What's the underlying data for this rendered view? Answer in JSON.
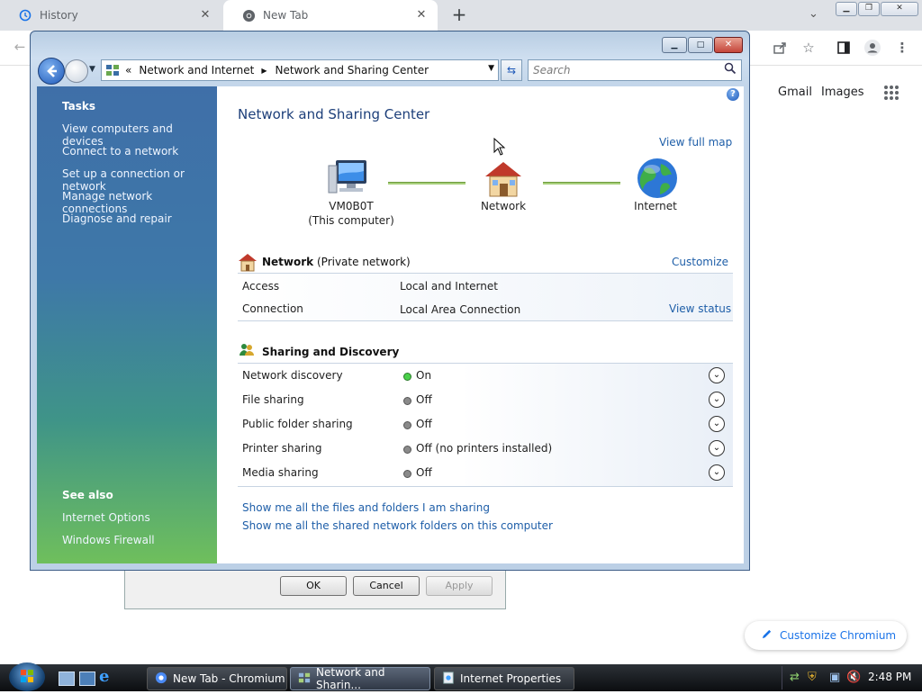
{
  "browser": {
    "tabs": [
      {
        "label": "History",
        "icon": "history-icon"
      },
      {
        "label": "New Tab",
        "icon": "chromium-icon"
      }
    ],
    "new_tab_symbol": "+",
    "ntp_links": [
      "Gmail",
      "Images"
    ],
    "customize_label": "Customize Chromium"
  },
  "props_dialog": {
    "ok": "OK",
    "cancel": "Cancel",
    "apply": "Apply"
  },
  "window": {
    "address": {
      "chevrons": "«",
      "crumb1": "Network and Internet",
      "crumb2": "Network and Sharing Center"
    },
    "search_placeholder": "Search",
    "sidebar": {
      "tasks_heading": "Tasks",
      "tasks": [
        "View computers and devices",
        "Connect to a network",
        "Set up a connection or network",
        "Manage network connections",
        "Diagnose and repair"
      ],
      "see_also_heading": "See also",
      "see_also": [
        "Internet Options",
        "Windows Firewall"
      ]
    },
    "title": "Network and Sharing Center",
    "view_full_map": "View full map",
    "map": {
      "computer_name": "VM0B0T",
      "computer_sub": "(This computer)",
      "network": "Network",
      "internet": "Internet"
    },
    "network_section": {
      "name": "Network",
      "type": "(Private network)",
      "customize": "Customize",
      "access_label": "Access",
      "access_value": "Local and Internet",
      "connection_label": "Connection",
      "connection_value": "Local Area Connection",
      "view_status": "View status"
    },
    "sharing": {
      "heading": "Sharing and Discovery",
      "rows": [
        {
          "label": "Network discovery",
          "value": "On"
        },
        {
          "label": "File sharing",
          "value": "Off"
        },
        {
          "label": "Public folder sharing",
          "value": "Off"
        },
        {
          "label": "Printer sharing",
          "value": "Off (no printers installed)"
        },
        {
          "label": "Media sharing",
          "value": "Off"
        }
      ]
    },
    "bottom_links": [
      "Show me all the files and folders I am sharing",
      "Show me all the shared network folders on this computer"
    ]
  },
  "taskbar": {
    "tasks": [
      "New Tab - Chromium",
      "Network and Sharin...",
      "Internet Properties"
    ],
    "clock": "2:48 PM"
  },
  "colors": {
    "link": "#1e5ea8",
    "discovery_on": "#4ad04a",
    "sidebar_top": "#3f6fa8",
    "sidebar_bottom": "#6fbf5c"
  }
}
